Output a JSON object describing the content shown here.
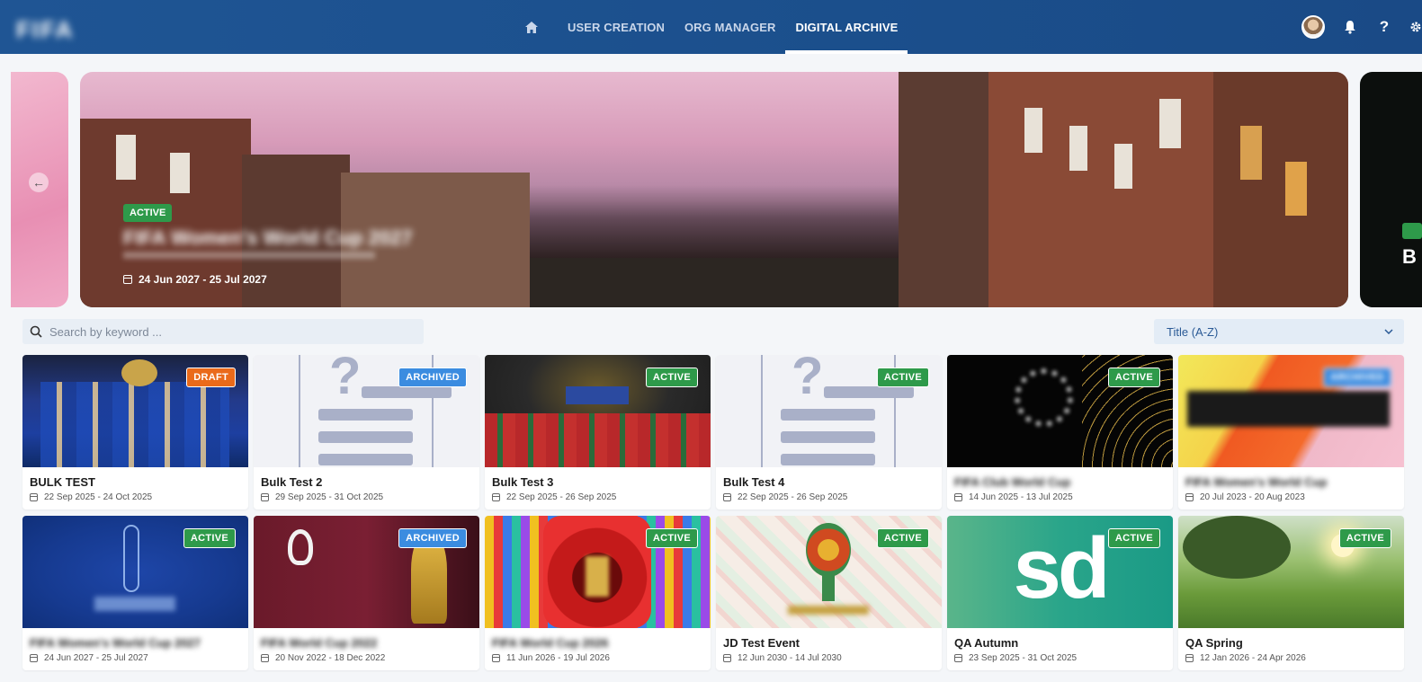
{
  "brand": {
    "logo_text": "FIFA"
  },
  "nav": {
    "home_icon": "home-icon",
    "items": [
      {
        "label": "USER CREATION",
        "active": false
      },
      {
        "label": "ORG MANAGER",
        "active": false
      },
      {
        "label": "DIGITAL ARCHIVE",
        "active": true
      }
    ]
  },
  "topright": {
    "icons": [
      "avatar",
      "bell-icon",
      "help-icon",
      "gear-icon"
    ],
    "help_glyph": "?"
  },
  "hero": {
    "status": "ACTIVE",
    "title": "FIFA Women's World Cup 2027",
    "date_range": "24 Jun 2027 - 25 Jul 2027",
    "right_peek_letter": "B"
  },
  "search": {
    "placeholder": "Search by keyword ..."
  },
  "sort": {
    "selected": "Title (A-Z)"
  },
  "colors": {
    "active": "#2e9a4a",
    "draft": "#ea6a1a",
    "archived": "#3b8ce0",
    "header": "#1f5594"
  },
  "cards": [
    {
      "title": "BULK TEST",
      "dates": "22 Sep 2025 - 24 Oct 2025",
      "status": "DRAFT",
      "blurred": false
    },
    {
      "title": "Bulk Test 2",
      "dates": "29 Sep 2025 - 31 Oct 2025",
      "status": "ARCHIVED",
      "blurred": false
    },
    {
      "title": "Bulk Test 3",
      "dates": "22 Sep 2025 - 26 Sep 2025",
      "status": "ACTIVE",
      "blurred": false
    },
    {
      "title": "Bulk Test 4",
      "dates": "22 Sep 2025 - 26 Sep 2025",
      "status": "ACTIVE",
      "blurred": false
    },
    {
      "title": "FIFA Club World Cup",
      "dates": "14 Jun 2025 - 13 Jul 2025",
      "status": "ACTIVE",
      "blurred": true
    },
    {
      "title": "FIFA Women's World Cup",
      "dates": "20 Jul 2023 - 20 Aug 2023",
      "status": "ARCHIVED",
      "blurred": true
    },
    {
      "title": "FIFA Women's World Cup 2027",
      "dates": "24 Jun 2027 - 25 Jul 2027",
      "status": "ACTIVE",
      "blurred": true
    },
    {
      "title": "FIFA World Cup 2022",
      "dates": "20 Nov 2022 - 18 Dec 2022",
      "status": "ARCHIVED",
      "blurred": true
    },
    {
      "title": "FIFA World Cup 2026",
      "dates": "11 Jun 2026 - 19 Jul 2026",
      "status": "ACTIVE",
      "blurred": true
    },
    {
      "title": "JD Test Event",
      "dates": "12 Jun 2030 - 14 Jul 2030",
      "status": "ACTIVE",
      "blurred": false
    },
    {
      "title": "QA Autumn",
      "dates": "23 Sep 2025 - 31 Oct 2025",
      "status": "ACTIVE",
      "blurred": false
    },
    {
      "title": "QA Spring",
      "dates": "12 Jan 2026 - 24 Apr 2026",
      "status": "ACTIVE",
      "blurred": false
    }
  ],
  "card_thumb_text": {
    "sd_logo": "sd"
  }
}
